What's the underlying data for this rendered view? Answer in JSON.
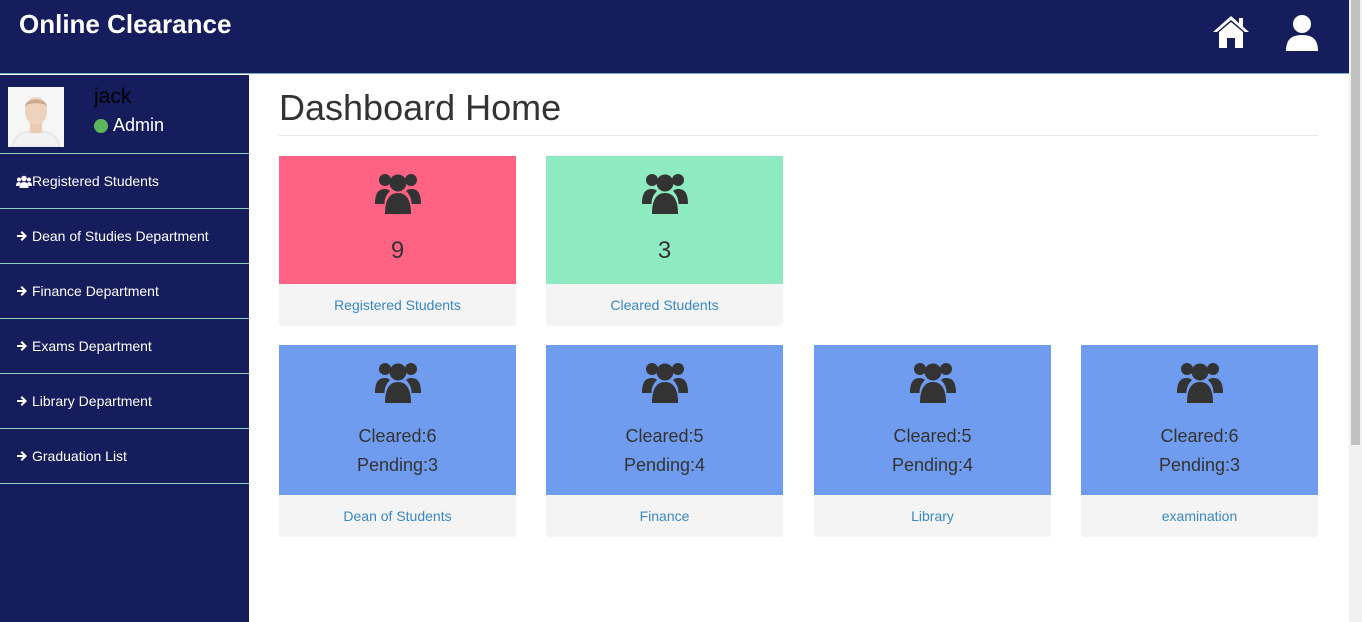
{
  "header": {
    "title": "Online Clearance"
  },
  "sidebar": {
    "profile": {
      "name": "jack",
      "role": "Admin"
    },
    "items": [
      {
        "label": "Registered Students",
        "icon": "users-icon"
      },
      {
        "label": "Dean of Studies Department",
        "icon": "arrow-right-icon"
      },
      {
        "label": "Finance Department",
        "icon": "arrow-right-icon"
      },
      {
        "label": "Exams Department",
        "icon": "arrow-right-icon"
      },
      {
        "label": "Library Department",
        "icon": "arrow-right-icon"
      },
      {
        "label": "Graduation List",
        "icon": "arrow-right-icon"
      }
    ]
  },
  "main": {
    "title": "Dashboard Home",
    "summary_cards": [
      {
        "value": "9",
        "link": "Registered Students",
        "color": "#ff6384"
      },
      {
        "value": "3",
        "link": "Cleared Students",
        "color": "#8eeac1"
      }
    ],
    "department_cards": [
      {
        "cleared": "Cleared:6",
        "pending": "Pending:3",
        "link": "Dean of Students",
        "color": "#6f9cee"
      },
      {
        "cleared": "Cleared:5",
        "pending": "Pending:4",
        "link": "Finance",
        "color": "#6f9cee"
      },
      {
        "cleared": "Cleared:5",
        "pending": "Pending:4",
        "link": "Library",
        "color": "#6f9cee"
      },
      {
        "cleared": "Cleared:6",
        "pending": "Pending:3",
        "link": "examination",
        "color": "#6f9cee"
      }
    ]
  },
  "colors": {
    "header_bg": "#161d5c",
    "sidebar_bg": "#161d5c",
    "online_status": "#5cb85c",
    "link": "#3a87c4"
  }
}
